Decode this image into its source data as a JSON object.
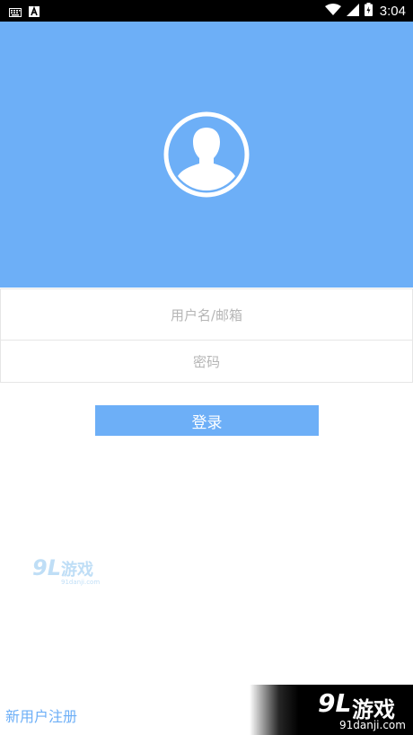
{
  "status_bar": {
    "time": "3:04",
    "left_icons": [
      "keyboard-icon",
      "a-notification-icon"
    ],
    "right_icons": [
      "wifi-icon",
      "signal-icon",
      "battery-icon"
    ]
  },
  "header": {
    "background_color": "#6daff7",
    "avatar_icon": "user-avatar-icon"
  },
  "form": {
    "username_placeholder": "用户名/邮箱",
    "username_value": "",
    "password_placeholder": "密码",
    "password_value": "",
    "login_label": "登录"
  },
  "footer": {
    "register_label": "新用户注册"
  },
  "watermarks": {
    "left_brand": "9L",
    "left_cn": "游戏",
    "left_site": "91danji.com",
    "right_brand": "9L",
    "right_cn": "游戏",
    "right_site": "91danji.com"
  },
  "colors": {
    "accent": "#6daff7",
    "field_border": "#e6e6e6",
    "placeholder": "#b5b5b5"
  }
}
